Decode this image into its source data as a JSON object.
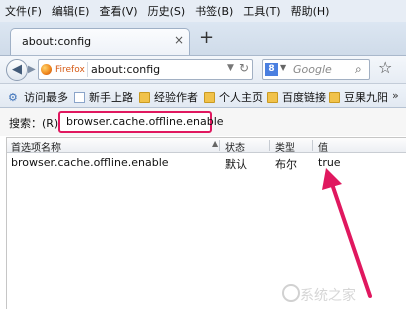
{
  "menubar": {
    "items": [
      "文件(F)",
      "编辑(E)",
      "查看(V)",
      "历史(S)",
      "书签(B)",
      "工具(T)",
      "帮助(H)"
    ]
  },
  "tab": {
    "title": "about:config",
    "close": "×",
    "new_tab": "+"
  },
  "navbar": {
    "identity_label": "Firefox",
    "url": "about:config",
    "search_placeholder": "Google",
    "search_engine_glyph": "8"
  },
  "bookmarks": {
    "items": [
      "访问最多",
      "新手上路",
      "经验作者",
      "个人主页",
      "百度链接",
      "豆果九阳"
    ],
    "overflow": "»"
  },
  "filter": {
    "label": "搜索：(R)",
    "value": "browser.cache.offline.enable"
  },
  "table": {
    "headers": [
      "首选项名称",
      "状态",
      "类型",
      "值"
    ],
    "rows": [
      {
        "name": "browser.cache.offline.enable",
        "status": "默认",
        "type": "布尔",
        "value": "true"
      }
    ]
  },
  "annotation": {
    "color": "#e0185f"
  },
  "watermark": {
    "text": "系统之家"
  }
}
